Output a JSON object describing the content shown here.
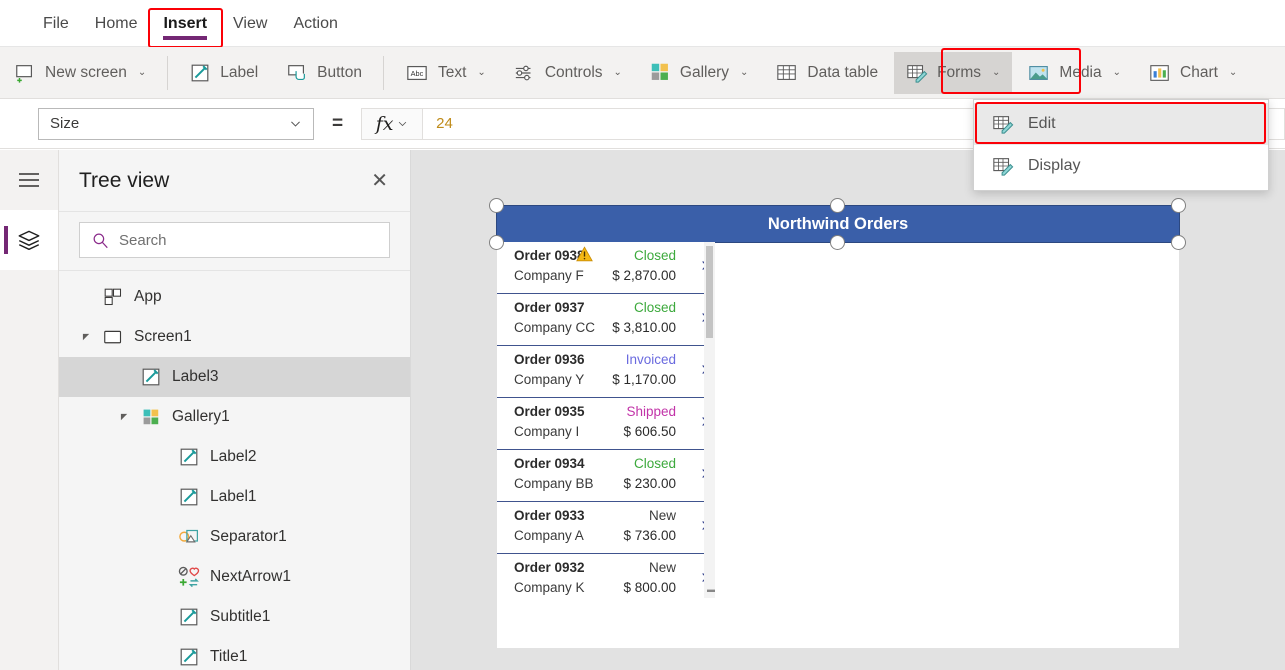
{
  "menubar": {
    "items": [
      {
        "label": "File",
        "active": false
      },
      {
        "label": "Home",
        "active": false
      },
      {
        "label": "Insert",
        "active": true
      },
      {
        "label": "View",
        "active": false
      },
      {
        "label": "Action",
        "active": false
      }
    ]
  },
  "ribbon": {
    "items": [
      {
        "label": "New screen",
        "icon": "new-screen-icon",
        "caret": true
      },
      {
        "label": "Label",
        "icon": "label-icon",
        "caret": false
      },
      {
        "label": "Button",
        "icon": "button-icon",
        "caret": false
      },
      {
        "label": "Text",
        "icon": "text-abc-icon",
        "caret": true
      },
      {
        "label": "Controls",
        "icon": "controls-sliders-icon",
        "caret": true
      },
      {
        "label": "Gallery",
        "icon": "gallery-squares-icon",
        "caret": true
      },
      {
        "label": "Data table",
        "icon": "data-table-icon",
        "caret": false
      },
      {
        "label": "Forms",
        "icon": "forms-icon",
        "caret": true,
        "selected": true
      },
      {
        "label": "Media",
        "icon": "media-image-icon",
        "caret": true
      },
      {
        "label": "Chart",
        "icon": "chart-bars-icon",
        "caret": true
      }
    ]
  },
  "dropdown": {
    "items": [
      {
        "label": "Edit",
        "icon": "forms-icon",
        "highlighted": true
      },
      {
        "label": "Display",
        "icon": "forms-icon",
        "highlighted": false
      }
    ]
  },
  "formula_bar": {
    "property": "Size",
    "equals": "=",
    "fx_label": "fx",
    "value": "24",
    "placeholder": ""
  },
  "tree_view": {
    "title": "Tree view",
    "close_label": "✕",
    "search": {
      "placeholder": "Search",
      "value": ""
    },
    "items": [
      {
        "label": "App",
        "indent": 0,
        "icon": "app-icon",
        "twisty": "none",
        "selected": false
      },
      {
        "label": "Screen1",
        "indent": 0,
        "icon": "screen-icon",
        "twisty": "expanded",
        "selected": false
      },
      {
        "label": "Label3",
        "indent": 1,
        "icon": "label-icon",
        "twisty": "none",
        "selected": true
      },
      {
        "label": "Gallery1",
        "indent": 1,
        "icon": "gallery-icon",
        "twisty": "expanded",
        "selected": false
      },
      {
        "label": "Label2",
        "indent": 2,
        "icon": "label-icon",
        "twisty": "none",
        "selected": false
      },
      {
        "label": "Label1",
        "indent": 2,
        "icon": "label-icon",
        "twisty": "none",
        "selected": false
      },
      {
        "label": "Separator1",
        "indent": 2,
        "icon": "separator-icon",
        "twisty": "none",
        "selected": false
      },
      {
        "label": "NextArrow1",
        "indent": 2,
        "icon": "next-arrow-icon",
        "twisty": "none",
        "selected": false
      },
      {
        "label": "Subtitle1",
        "indent": 2,
        "icon": "label-icon",
        "twisty": "none",
        "selected": false
      },
      {
        "label": "Title1",
        "indent": 2,
        "icon": "label-icon",
        "twisty": "none",
        "selected": false
      }
    ]
  },
  "canvas": {
    "app_title": "Northwind Orders",
    "gallery": {
      "rows": [
        {
          "order": "Order 0938",
          "company": "Company F",
          "status": "Closed",
          "amount": "$ 2,870.00",
          "status_color": "#3ca93c",
          "warning": true
        },
        {
          "order": "Order 0937",
          "company": "Company CC",
          "status": "Closed",
          "amount": "$ 3,810.00",
          "status_color": "#3ca93c",
          "warning": false
        },
        {
          "order": "Order 0936",
          "company": "Company Y",
          "status": "Invoiced",
          "amount": "$ 1,170.00",
          "status_color": "#6a6adf",
          "warning": false
        },
        {
          "order": "Order 0935",
          "company": "Company I",
          "status": "Shipped",
          "amount": "$ 606.50",
          "status_color": "#c233a8",
          "warning": false
        },
        {
          "order": "Order 0934",
          "company": "Company BB",
          "status": "Closed",
          "amount": "$ 230.00",
          "status_color": "#3ca93c",
          "warning": false
        },
        {
          "order": "Order 0933",
          "company": "Company A",
          "status": "New",
          "amount": "$ 736.00",
          "status_color": "#3a3a3a",
          "warning": false
        },
        {
          "order": "Order 0932",
          "company": "Company K",
          "status": "New",
          "amount": "$ 800.00",
          "status_color": "#3a3a3a",
          "warning": false
        }
      ],
      "chevron": "›"
    }
  },
  "colors": {
    "accent_purple": "#742774",
    "highlight_red": "#fb0007",
    "header_blue": "#3a5fa9",
    "formula_value": "#bf8b19",
    "status_closed": "#3ca93c",
    "status_invoiced": "#6a6adf",
    "status_shipped": "#c233a8",
    "ribbon_bg": "#f3f2f1",
    "canvas_bg": "#e2e2e2"
  }
}
